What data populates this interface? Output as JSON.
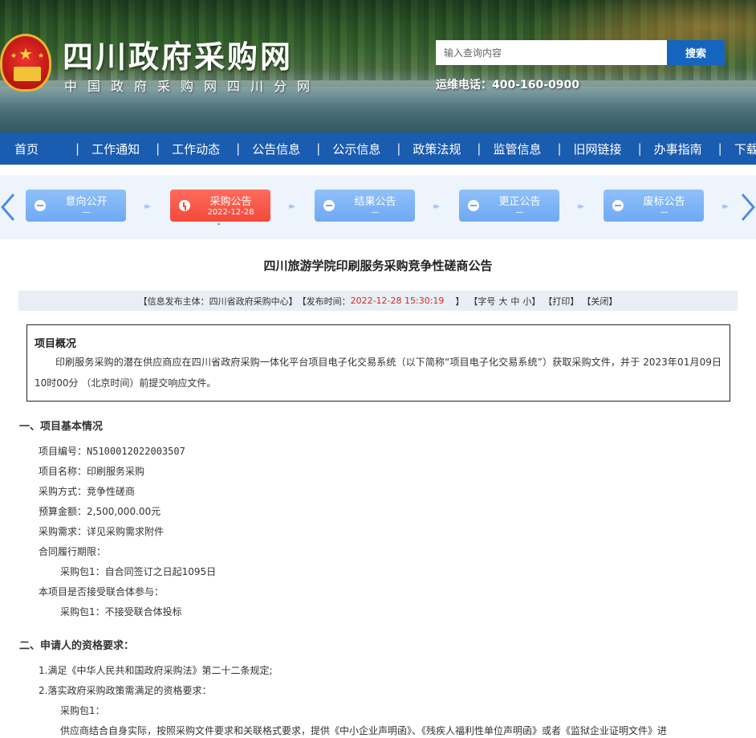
{
  "header": {
    "site_title": "四川政府采购网",
    "site_subtitle": "中国政府采购网四川分网",
    "search_placeholder": "输入查询内容",
    "search_button": "搜索",
    "hotline": "运维电话：400-160-0900"
  },
  "nav": {
    "items": [
      "首页",
      "工作通知",
      "工作动态",
      "公告信息",
      "公示信息",
      "政策法规",
      "监管信息",
      "旧网链接",
      "办事指南",
      "下载专区"
    ]
  },
  "categories": [
    {
      "label": "意向公开",
      "date": "—",
      "active": false
    },
    {
      "label": "采购公告",
      "date": "2022-12-28",
      "active": true
    },
    {
      "label": "结果公告",
      "date": "—",
      "active": false
    },
    {
      "label": "更正公告",
      "date": "—",
      "active": false
    },
    {
      "label": "废标公告",
      "date": "—",
      "active": false
    }
  ],
  "article": {
    "title": "四川旅游学院印刷服务采购竞争性磋商公告",
    "meta": {
      "publisher": "【信息发布主体：四川省政府采购中心】",
      "time_label": "【发布时间：",
      "time_value": "2022-12-28 15:30:19",
      "time_close": "】",
      "font_size": "【字号",
      "font_large": "大",
      "font_medium": "中",
      "font_small": "小】",
      "print": "【打印】",
      "close": "【关闭】"
    },
    "overview": {
      "title": "项目概况",
      "text": "印刷服务采购的潜在供应商应在四川省政府采购一体化平台项目电子化交易系统（以下简称“项目电子化交易系统”）获取采购文件，并于 2023年01月09日 10时00分 （北京时间）前提交响应文件。"
    },
    "section1": {
      "heading": "一、项目基本情况",
      "lines": [
        "项目编号：N5100012022003507",
        "项目名称：印刷服务采购",
        "采购方式：竞争性磋商",
        "预算金额：2,500,000.00元",
        "采购需求：详见采购需求附件",
        "合同履行期限：",
        "采购包1：自合同签订之日起1095日",
        "本项目是否接受联合体参与：",
        "采购包1：不接受联合体投标"
      ]
    },
    "section2": {
      "heading": "二、申请人的资格要求：",
      "lines": [
        "1.满足《中华人民共和国政府采购法》第二十二条规定;",
        "2.落实政府采购政策需满足的资格要求：",
        "采购包1：",
        "供应商结合自身实际，按照采购文件要求和关联格式要求，提供《中小企业声明函》、《残疾人福利性单位声明函》或者《监狱企业证明文件》进"
      ]
    }
  }
}
